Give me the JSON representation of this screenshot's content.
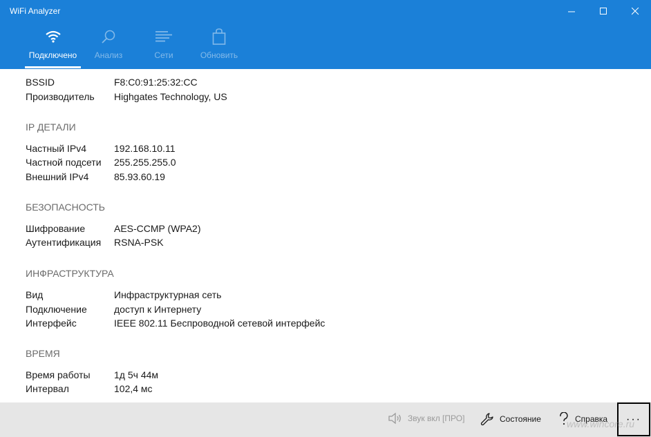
{
  "window": {
    "title": "WiFi Analyzer",
    "minimize_glyph": "—",
    "maximize_glyph": "☐",
    "close_glyph": "✕"
  },
  "nav": {
    "tabs": [
      {
        "label": "Подключено",
        "icon": "wifi-icon",
        "active": true
      },
      {
        "label": "Анализ",
        "icon": "magnifier-icon",
        "active": false
      },
      {
        "label": "Сети",
        "icon": "list-icon",
        "active": false
      },
      {
        "label": "Обновить",
        "icon": "shopping-bag-icon",
        "active": false
      }
    ]
  },
  "details": {
    "general": [
      {
        "key": "BSSID",
        "value": "F8:C0:91:25:32:CC"
      },
      {
        "key": "Производитель",
        "value": "Highgates Technology, US"
      }
    ],
    "ip": {
      "heading": "IP ДЕТАЛИ",
      "rows": [
        {
          "key": "Частный IPv4",
          "value": "192.168.10.11"
        },
        {
          "key": "Частной подсети",
          "value": "255.255.255.0"
        },
        {
          "key": "Внешний IPv4",
          "value": "85.93.60.19"
        }
      ]
    },
    "security": {
      "heading": "БЕЗОПАСНОСТЬ",
      "rows": [
        {
          "key": "Шифрование",
          "value": "AES-CCMP (WPA2)"
        },
        {
          "key": "Аутентификация",
          "value": "RSNA-PSK"
        }
      ]
    },
    "infra": {
      "heading": "ИНФРАСТРУКТУРА",
      "rows": [
        {
          "key": "Вид",
          "value": "Инфраструктурная сеть"
        },
        {
          "key": "Подключение",
          "value": "доступ к Интернету"
        },
        {
          "key": "Интерфейс",
          "value": "IEEE 802.11 Беспроводной сетевой интерфейс"
        }
      ]
    },
    "time": {
      "heading": "ВРЕМЯ",
      "rows": [
        {
          "key": "Время работы",
          "value": "1д 5ч 44м"
        },
        {
          "key": "Интервал",
          "value": "102,4 мс"
        }
      ]
    }
  },
  "bottombar": {
    "sound_label": "Звук вкл [ПРО]",
    "status_label": "Состояние",
    "help_label": "Справка",
    "more_label": "···"
  },
  "watermark": "www.wincore.ru",
  "colors": {
    "accent": "#1b80d8",
    "bottombar": "#e6e6e6"
  }
}
